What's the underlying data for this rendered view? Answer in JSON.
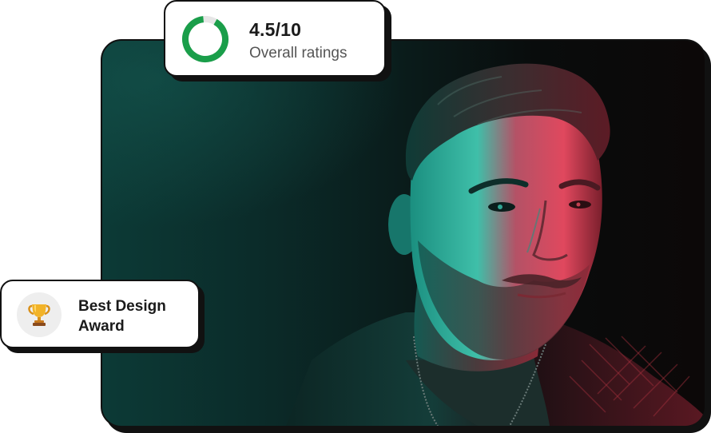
{
  "photo": {
    "subject": "portrait-photo",
    "lighting": {
      "left_color": "#1fb8a4",
      "right_color": "#e0485e",
      "background": "#0b1a19"
    }
  },
  "ratings_card": {
    "value": "4.5/10",
    "label": "Overall ratings",
    "ring_fraction": 0.9,
    "ring_color": "#1a9e4a",
    "ring_track_color": "#e6e6e6"
  },
  "award_card": {
    "text": "Best Design Award",
    "icon": "trophy-icon"
  }
}
